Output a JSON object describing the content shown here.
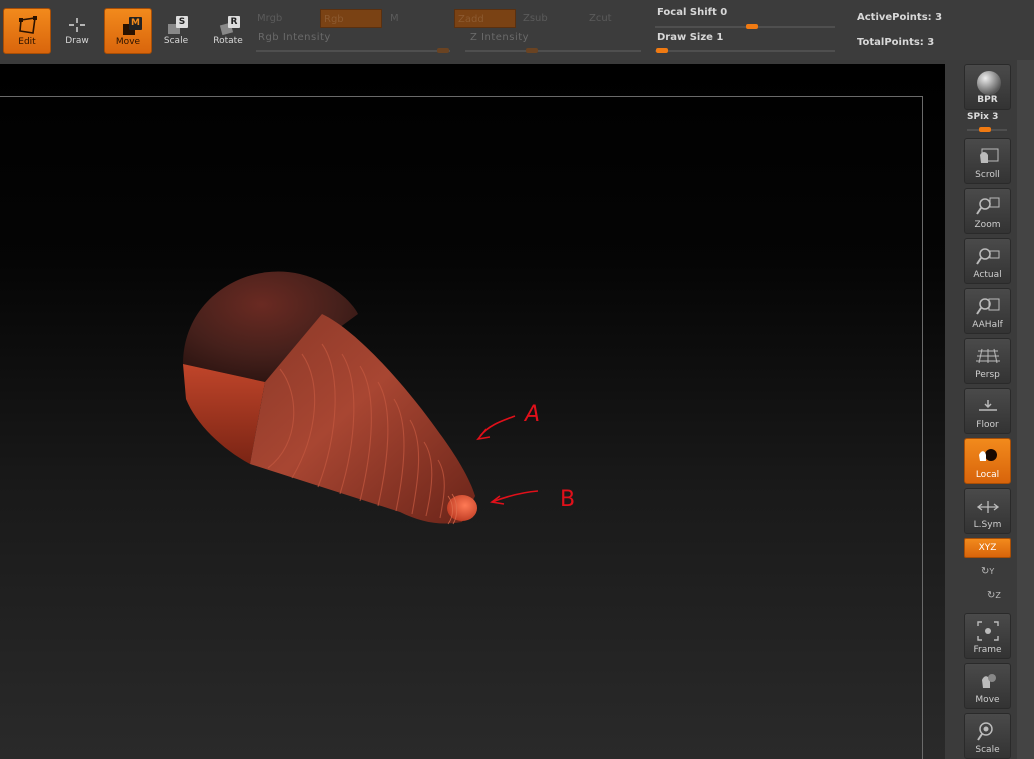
{
  "toolbar": {
    "tools": [
      {
        "label": "Edit",
        "key": "",
        "active": true,
        "icon": "edit-icon"
      },
      {
        "label": "Draw",
        "key": "",
        "active": false,
        "icon": "draw-icon"
      },
      {
        "label": "Move",
        "key": "M",
        "active": true,
        "icon": "move-icon"
      },
      {
        "label": "Scale",
        "key": "S",
        "active": false,
        "icon": "scale-icon"
      },
      {
        "label": "Rotate",
        "key": "R",
        "active": false,
        "icon": "rotate-icon"
      }
    ],
    "options": {
      "mrgb": "Mrgb",
      "rgb": "Rgb",
      "m": "M",
      "zadd": "Zadd",
      "zsub": "Zsub",
      "zcut": "Zcut"
    },
    "rgb_intensity_label": "Rgb  Intensity",
    "z_intensity_label": "Z  Intensity",
    "focal_shift_label": "Focal  Shift",
    "focal_shift_value": "0",
    "draw_size_label": "Draw  Size",
    "draw_size_value": "1",
    "active_points_label": "ActivePoints:",
    "active_points_value": "3",
    "total_points_label": "TotalPoints:",
    "total_points_value": "3"
  },
  "annotations": {
    "a": "A",
    "b": "B"
  },
  "shelf": {
    "bpr": "BPR",
    "spix_label": "SPix",
    "spix_value": "3",
    "buttons": [
      {
        "label": "Scroll",
        "icon": "scroll-hand-icon",
        "active": false
      },
      {
        "label": "Zoom",
        "icon": "zoom-icon",
        "active": false
      },
      {
        "label": "Actual",
        "icon": "actual-size-icon",
        "active": false
      },
      {
        "label": "AAHalf",
        "icon": "aahalf-icon",
        "active": false
      },
      {
        "label": "Persp",
        "icon": "perspective-icon",
        "active": false
      },
      {
        "label": "Floor",
        "icon": "floor-icon",
        "active": false
      },
      {
        "label": "Local",
        "icon": "local-icon",
        "active": true
      },
      {
        "label": "L.Sym",
        "icon": "local-symmetry-icon",
        "active": false
      },
      {
        "label": "Frame",
        "icon": "frame-icon",
        "active": false
      },
      {
        "label": "Move",
        "icon": "move-hand-icon",
        "active": false
      },
      {
        "label": "Scale",
        "icon": "scale-zoom-icon",
        "active": false
      }
    ],
    "xyz": "XYZ",
    "y_rot": "Y",
    "z_rot": "Z"
  }
}
